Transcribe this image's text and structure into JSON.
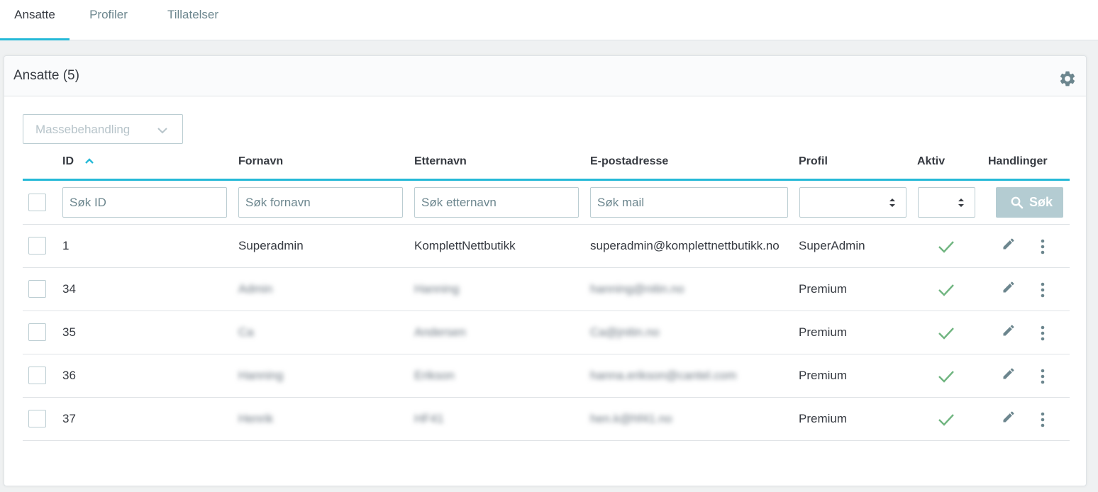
{
  "tabs": [
    "Ansatte",
    "Profiler",
    "Tillatelser"
  ],
  "card": {
    "title": "Ansatte (5)"
  },
  "bulk_action": {
    "label": "Massebehandling"
  },
  "columns": [
    "ID",
    "Fornavn",
    "Etternavn",
    "E-postadresse",
    "Profil",
    "Aktiv",
    "Handlinger"
  ],
  "filters": {
    "id_placeholder": "Søk ID",
    "firstname_placeholder": "Søk fornavn",
    "lastname_placeholder": "Søk etternavn",
    "email_placeholder": "Søk mail",
    "profile_value": "",
    "active_value": "",
    "search_label": "Søk"
  },
  "rows": [
    {
      "id": "1",
      "firstname": "Superadmin",
      "lastname": "KomplettNettbutikk",
      "email": "superadmin@komplettnettbutikk.no",
      "profile": "SuperAdmin",
      "active": true
    },
    {
      "id": "34",
      "firstname": "Admin",
      "lastname": "Hanning",
      "email": "hanning@nitin.no",
      "profile": "Premium",
      "active": true
    },
    {
      "id": "35",
      "firstname": "Ca",
      "lastname": "Andersen",
      "email": "Ca@jnitin.no",
      "profile": "Premium",
      "active": true
    },
    {
      "id": "36",
      "firstname": "Hanning",
      "lastname": "Erikson",
      "email": "hanna.erikson@cantel.com",
      "profile": "Premium",
      "active": true
    },
    {
      "id": "37",
      "firstname": "Henrik",
      "lastname": "HF41",
      "email": "hen.k@hf41.no",
      "profile": "Premium",
      "active": true
    }
  ],
  "colors": {
    "accent": "#25b9d7",
    "success": "#70b580",
    "search_button": "#b4ccd2",
    "icon": "#6c868e"
  },
  "icons": {
    "settings": "gear-icon",
    "sort": "sort-asc-icon",
    "edit": "pencil-icon",
    "more": "kebab-icon",
    "active": "check-icon",
    "search": "search-icon"
  }
}
